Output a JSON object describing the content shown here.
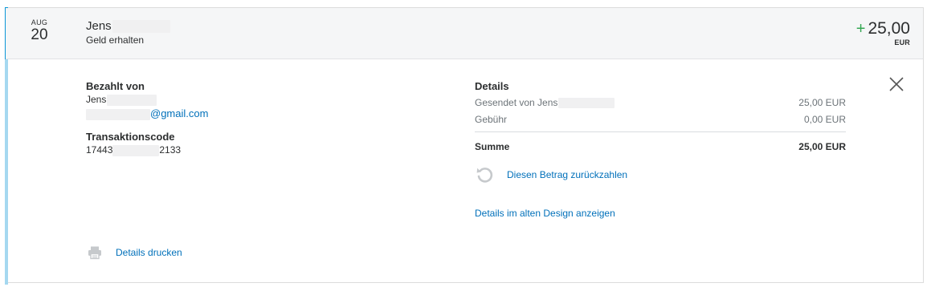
{
  "transaction": {
    "date": {
      "month": "AUG",
      "day": "20"
    },
    "party_name": "Jens",
    "type": "Geld erhalten",
    "amount_sign": "+",
    "amount": "25,00",
    "currency": "EUR"
  },
  "paid_by": {
    "title": "Bezahlt von",
    "name": "Jens",
    "email": "@gmail.com"
  },
  "transaction_code": {
    "title": "Transaktionscode",
    "prefix": "17443",
    "suffix": "2133"
  },
  "details": {
    "title": "Details",
    "rows": [
      {
        "label": "Gesendet von Jens",
        "value": "25,00 EUR"
      },
      {
        "label": "Gebühr",
        "value": "0,00 EUR"
      }
    ],
    "total": {
      "label": "Summe",
      "value": "25,00 EUR"
    }
  },
  "actions": {
    "refund": "Diesen Betrag zurückzahlen",
    "old_design": "Details im alten Design anzeigen",
    "print": "Details drucken"
  },
  "icons": {
    "close": "close-icon",
    "refund": "refresh-icon",
    "print": "printer-icon"
  },
  "colors": {
    "accent": "#0a96d6",
    "link": "#0070ba",
    "positive": "#34a853"
  }
}
